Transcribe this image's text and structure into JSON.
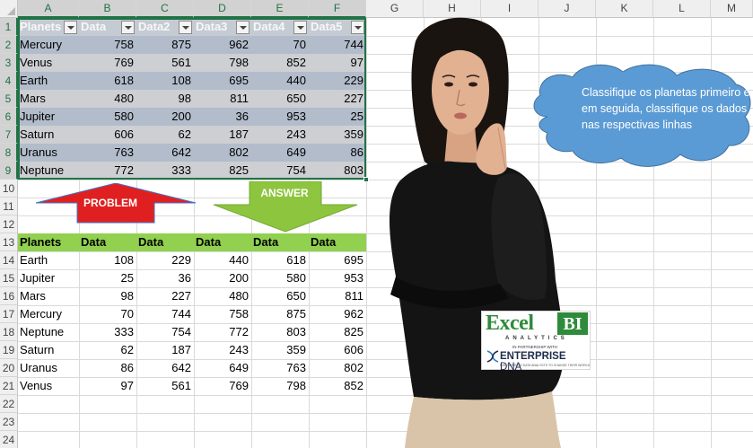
{
  "spreadsheet": {
    "columns": [
      "A",
      "B",
      "C",
      "D",
      "E",
      "F",
      "G",
      "H",
      "I",
      "J",
      "K",
      "L",
      "M"
    ],
    "rows": [
      "1",
      "2",
      "3",
      "4",
      "5",
      "6",
      "7",
      "8",
      "9",
      "10",
      "11",
      "12",
      "13",
      "14",
      "15",
      "16",
      "17",
      "18",
      "19",
      "20",
      "21",
      "22",
      "23",
      "24"
    ]
  },
  "problem_table": {
    "headers": [
      "Planets",
      "Data",
      "Data2",
      "Data3",
      "Data4",
      "Data5"
    ],
    "rows": [
      {
        "planet": "Mercury",
        "values": [
          758,
          875,
          962,
          70,
          744
        ]
      },
      {
        "planet": "Venus",
        "values": [
          769,
          561,
          798,
          852,
          97
        ]
      },
      {
        "planet": "Earth",
        "values": [
          618,
          108,
          695,
          440,
          229
        ]
      },
      {
        "planet": "Mars",
        "values": [
          480,
          98,
          811,
          650,
          227
        ]
      },
      {
        "planet": "Jupiter",
        "values": [
          580,
          200,
          36,
          953,
          25
        ]
      },
      {
        "planet": "Saturn",
        "values": [
          606,
          62,
          187,
          243,
          359
        ]
      },
      {
        "planet": "Uranus",
        "values": [
          763,
          642,
          802,
          649,
          86
        ]
      },
      {
        "planet": "Neptune",
        "values": [
          772,
          333,
          825,
          754,
          803
        ]
      }
    ]
  },
  "labels": {
    "problem": "PROBLEM",
    "answer": "ANSWER"
  },
  "answer_table": {
    "headers": [
      "Planets",
      "Data",
      "Data",
      "Data",
      "Data",
      "Data"
    ],
    "rows": [
      {
        "planet": "Earth",
        "values": [
          108,
          229,
          440,
          618,
          695
        ]
      },
      {
        "planet": "Jupiter",
        "values": [
          25,
          36,
          200,
          580,
          953
        ]
      },
      {
        "planet": "Mars",
        "values": [
          98,
          227,
          480,
          650,
          811
        ]
      },
      {
        "planet": "Mercury",
        "values": [
          70,
          744,
          758,
          875,
          962
        ]
      },
      {
        "planet": "Neptune",
        "values": [
          333,
          754,
          772,
          803,
          825
        ]
      },
      {
        "planet": "Saturn",
        "values": [
          62,
          187,
          243,
          359,
          606
        ]
      },
      {
        "planet": "Uranus",
        "values": [
          86,
          642,
          649,
          763,
          802
        ]
      },
      {
        "planet": "Venus",
        "values": [
          97,
          561,
          769,
          798,
          852
        ]
      }
    ]
  },
  "callout": {
    "text": "Classifique os planetas primeiro e, em seguida, classifique os dados nas respectivas linhas"
  },
  "logo": {
    "excel": "Excel",
    "bi": "BI",
    "analytics": "ANALYTICS",
    "partnership": "IN PARTNERSHIP WITH",
    "enterprise": "ENTERPRISE",
    "dna": "DNA",
    "tagline": "EMPOWERING DATA ANALYSTS TO CHANGE THEIR WORLD"
  },
  "colors": {
    "accent_green": "#217346",
    "problem_arrow": "#e02020",
    "answer_arrow": "#8dc53e",
    "cloud": "#5b9bd5",
    "answer_header": "#92d050"
  }
}
